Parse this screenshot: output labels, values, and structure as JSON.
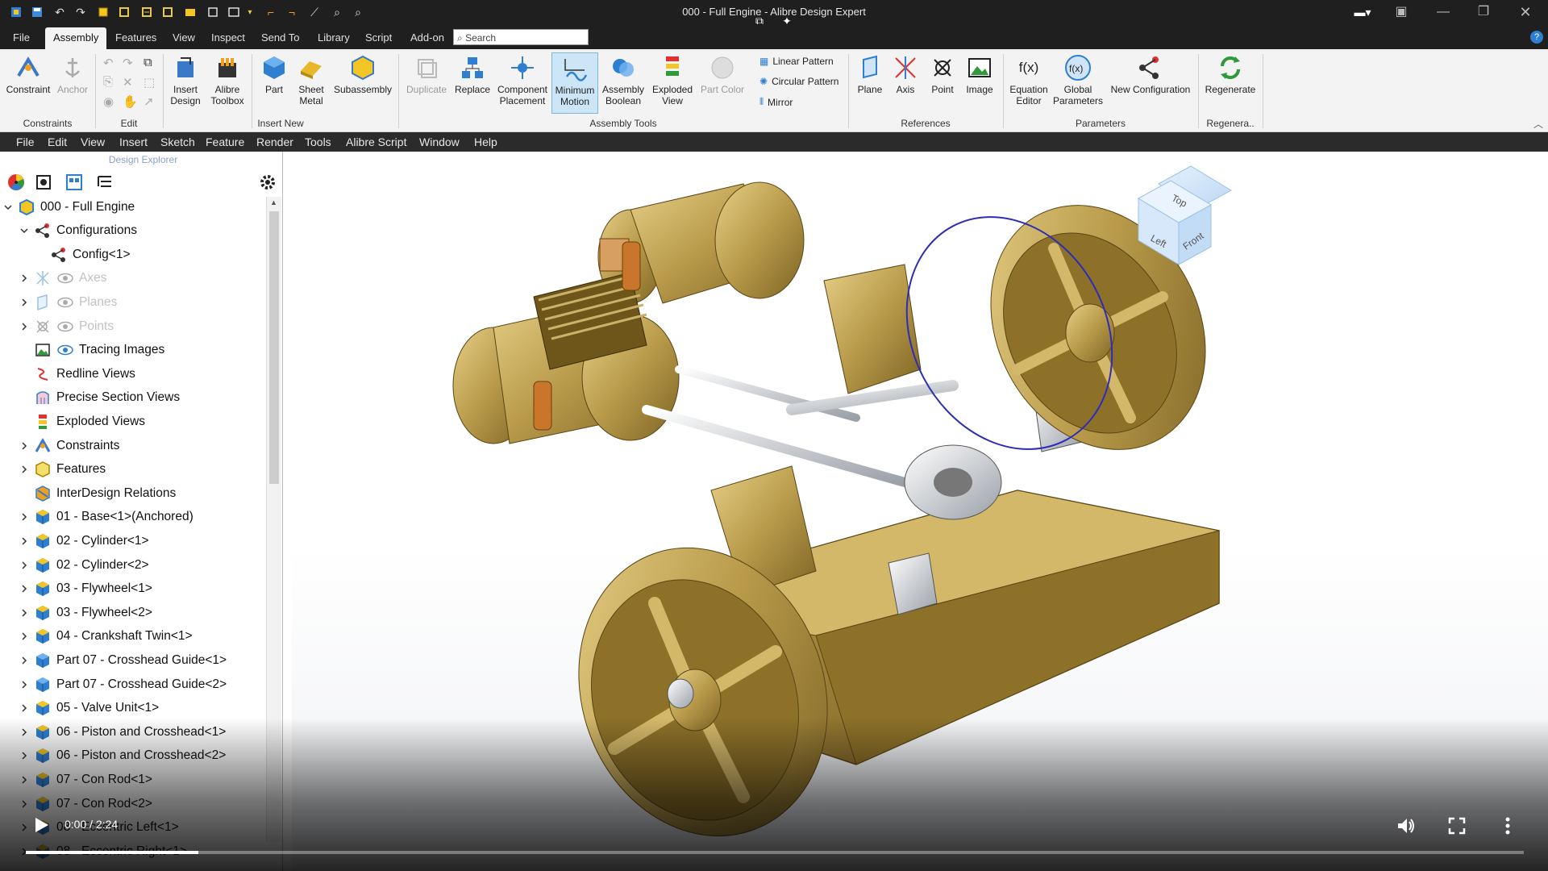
{
  "window": {
    "title": "000 - Full Engine - Alibre Design Expert"
  },
  "ribbon_tabs": [
    "File",
    "Assembly",
    "Features",
    "View",
    "Inspect",
    "Send To",
    "Library",
    "Script",
    "Add-on"
  ],
  "search": {
    "placeholder": "Search"
  },
  "ribbon": {
    "buttons": {
      "constraint": "Constraint",
      "anchor": "Anchor",
      "insert_design": [
        "Insert",
        "Design"
      ],
      "alibre_toolbox": [
        "Alibre",
        "Toolbox"
      ],
      "part": "Part",
      "sheet_metal": [
        "Sheet",
        "Metal"
      ],
      "subassembly": "Subassembly",
      "duplicate": "Duplicate",
      "replace": "Replace",
      "component_placement": [
        "Component",
        "Placement"
      ],
      "minimum_motion": [
        "Minimum",
        "Motion"
      ],
      "assembly_boolean": [
        "Assembly",
        "Boolean"
      ],
      "exploded_view": [
        "Exploded",
        "View"
      ],
      "part_color": "Part Color",
      "linear_pattern": "Linear Pattern",
      "circular_pattern": "Circular Pattern",
      "mirror": "Mirror",
      "plane": "Plane",
      "axis": "Axis",
      "point": "Point",
      "image": "Image",
      "equation_editor": [
        "Equation",
        "Editor"
      ],
      "global_parameters": [
        "Global",
        "Parameters"
      ],
      "new_configuration": "New Configuration",
      "regenerate": "Regenerate"
    },
    "groups": [
      "Constraints",
      "Edit",
      "Insert New",
      "Assembly Tools",
      "References",
      "Parameters",
      "Regenera.."
    ]
  },
  "menubar": [
    "File",
    "Edit",
    "View",
    "Insert",
    "Sketch",
    "Feature",
    "Render",
    "Tools",
    "Alibre Script",
    "Window",
    "Help"
  ],
  "explorer": {
    "title": "Design Explorer",
    "tree": [
      {
        "label": "000 - Full Engine",
        "level": 0,
        "expand": "open",
        "icon": "assembly-icon"
      },
      {
        "label": "Configurations",
        "level": 1,
        "expand": "open",
        "icon": "configuration-icon"
      },
      {
        "label": "Config<1>",
        "level": 2,
        "expand": "none",
        "icon": "configuration-icon"
      },
      {
        "label": "Axes",
        "level": 1,
        "expand": "closed",
        "icon": "axes-icon",
        "dim": true
      },
      {
        "label": "Planes",
        "level": 1,
        "expand": "closed",
        "icon": "planes-icon",
        "dim": true
      },
      {
        "label": "Points",
        "level": 1,
        "expand": "closed",
        "icon": "points-icon",
        "dim": true
      },
      {
        "label": "Tracing Images",
        "level": 1,
        "expand": "none",
        "icon": "image-icon",
        "eye": true
      },
      {
        "label": "Redline Views",
        "level": 1,
        "expand": "none",
        "icon": "redline-icon"
      },
      {
        "label": "Precise Section Views",
        "level": 1,
        "expand": "none",
        "icon": "section-icon"
      },
      {
        "label": "Exploded Views",
        "level": 1,
        "expand": "none",
        "icon": "exploded-icon"
      },
      {
        "label": "Constraints",
        "level": 1,
        "expand": "closed",
        "icon": "constraint-icon"
      },
      {
        "label": "Features",
        "level": 1,
        "expand": "closed",
        "icon": "feature-icon"
      },
      {
        "label": "InterDesign Relations",
        "level": 1,
        "expand": "none",
        "icon": "relation-icon"
      },
      {
        "label": "01 - Base<1>(Anchored)",
        "level": 1,
        "expand": "closed",
        "icon": "part-icon"
      },
      {
        "label": "02 - Cylinder<1>",
        "level": 1,
        "expand": "closed",
        "icon": "part-icon"
      },
      {
        "label": "02 - Cylinder<2>",
        "level": 1,
        "expand": "closed",
        "icon": "part-icon"
      },
      {
        "label": "03 - Flywheel<1>",
        "level": 1,
        "expand": "closed",
        "icon": "part-icon"
      },
      {
        "label": "03 - Flywheel<2>",
        "level": 1,
        "expand": "closed",
        "icon": "part-icon"
      },
      {
        "label": "04 - Crankshaft Twin<1>",
        "level": 1,
        "expand": "closed",
        "icon": "part-icon"
      },
      {
        "label": "Part 07 - Crosshead Guide<1>",
        "level": 1,
        "expand": "closed",
        "icon": "sheet-part-icon"
      },
      {
        "label": "Part 07 - Crosshead Guide<2>",
        "level": 1,
        "expand": "closed",
        "icon": "sheet-part-icon"
      },
      {
        "label": "05 - Valve Unit<1>",
        "level": 1,
        "expand": "closed",
        "icon": "part-icon"
      },
      {
        "label": "06 - Piston and Crosshead<1>",
        "level": 1,
        "expand": "closed",
        "icon": "part-icon"
      },
      {
        "label": "06 - Piston and Crosshead<2>",
        "level": 1,
        "expand": "closed",
        "icon": "part-icon"
      },
      {
        "label": "07 - Con Rod<1>",
        "level": 1,
        "expand": "closed",
        "icon": "part-icon"
      },
      {
        "label": "07 - Con Rod<2>",
        "level": 1,
        "expand": "closed",
        "icon": "part-icon"
      },
      {
        "label": "08 - Eccentric Left<1>",
        "level": 1,
        "expand": "closed",
        "icon": "part-icon"
      },
      {
        "label": "08 - Eccentric Right<1>",
        "level": 1,
        "expand": "closed",
        "icon": "part-icon"
      }
    ]
  },
  "viewcube": {
    "top": "Top",
    "left": "Left",
    "front": "Front"
  },
  "video": {
    "time": "0:00 / 2:24",
    "progress": 0.115
  },
  "colors": {
    "brass": "#b89a4a",
    "selection": "#2d2db5",
    "ribbon_bg": "#f3f3f3",
    "menubar_bg": "#2b2b2b"
  }
}
